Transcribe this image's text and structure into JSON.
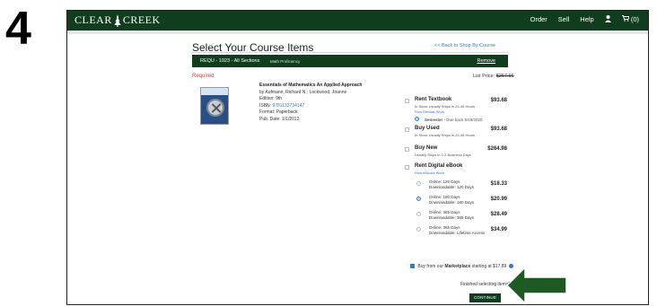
{
  "step": "4",
  "brand": {
    "left": "CLEAR",
    "right": "CREEK"
  },
  "nav": {
    "order": "Order",
    "sell": "Sell",
    "help": "Help",
    "cart": "(0)"
  },
  "page": {
    "title": "Select Your Course Items",
    "back_link": "<< Back to Shop By Course"
  },
  "course": {
    "code": "REQU - 1023 - All Sections",
    "subtitle": "Math Proficiency",
    "remove_label": "Remove",
    "required_label": "Required",
    "list_price_label": "List Price:",
    "list_price_value": "$267.66"
  },
  "book": {
    "title": "Essentials of Mathematics An Applied Approach",
    "authors": "by Aufmann, Richard N.; Lockwood, Joanne",
    "edition": "Edition: 9th",
    "isbn_label": "ISBN:",
    "isbn_value": "9781133734147",
    "format": "Format: Paperback",
    "pub_date": "Pub. Date: 1/1/2013"
  },
  "options": {
    "rent": {
      "label": "Rent Textbook",
      "note": "In Stock Usually Ships in 24-48 Hours",
      "link": "How Rentals Work",
      "term": "Semester",
      "term_note": "- Due back 5/15/2020",
      "price": "$93.68"
    },
    "used": {
      "label": "Buy Used",
      "note": "In Stock Usually Ships in 24-48 Hours",
      "price": "$93.68"
    },
    "new": {
      "label": "Buy New",
      "note": "Usually Ships in 2-3 Business Days",
      "price": "$264.98"
    },
    "digital": {
      "label": "Rent Digital eBook",
      "link": "How eBooks Work",
      "rows": [
        {
          "online": "Online: 120 Days",
          "download": "Downloadable: 120 Days",
          "price": "$18.33"
        },
        {
          "online": "Online: 180 Days",
          "download": "Downloadable: 180 Days",
          "price": "$20.99"
        },
        {
          "online": "Online: 365 Days",
          "download": "Downloadable: 365 Days",
          "price": "$28.49"
        },
        {
          "online": "Online: 365 Days",
          "download": "Downloadable: Lifetime Access",
          "price": "$34.99"
        }
      ]
    }
  },
  "marketplace": {
    "pre": "Buy from our ",
    "bold": "Marketplace",
    "post": " starting at $17.89"
  },
  "footer": {
    "finished": "Finished selecting items?",
    "continue": "CONTINUE"
  },
  "colors": {
    "brand_green": "#0f3d1d",
    "link_blue": "#3a78c9",
    "required_red": "#d43b2f",
    "arrow_green": "#1e5a24"
  }
}
